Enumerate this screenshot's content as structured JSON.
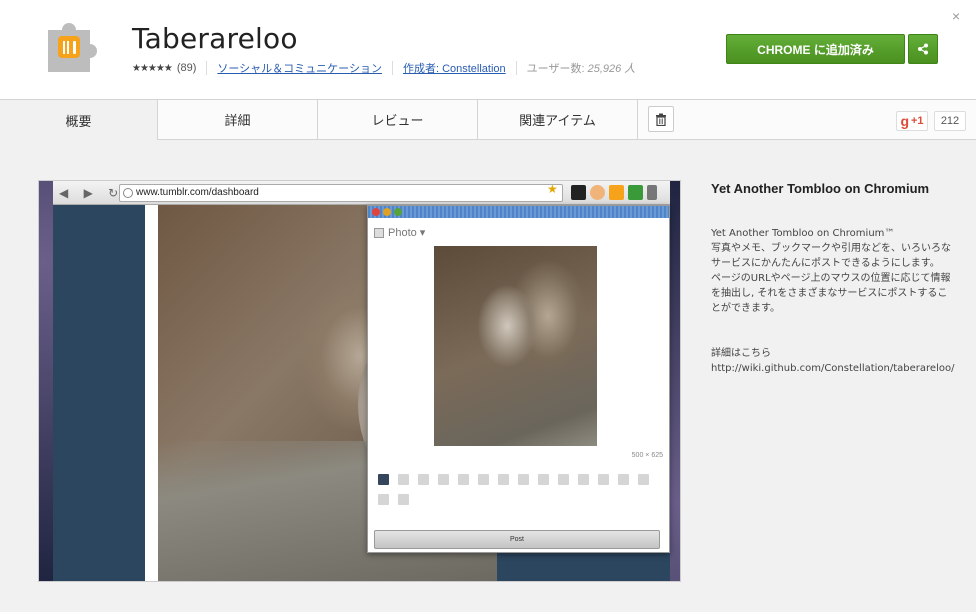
{
  "header": {
    "title": "Taberareloo",
    "rating_stars": "★★★★★",
    "rating_count": "(89)",
    "category": "ソーシャル＆コミュニケーション",
    "author": "作成者: Constellation",
    "users_label": "ユーザー数: ",
    "users_count": "25,926 人",
    "add_button": "CHROME に追加済み",
    "close": "×"
  },
  "tabs": [
    {
      "label": "概要"
    },
    {
      "label": "詳細"
    },
    {
      "label": "レビュー"
    },
    {
      "label": "関連アイテム"
    }
  ],
  "gplus": {
    "g": "g",
    "plus_one": "+1",
    "count": "212"
  },
  "screenshot": {
    "url": "www.tumblr.com/dashboard",
    "popup_type": "Photo ▾",
    "image_size": "500 × 625",
    "post_button": "Post"
  },
  "description": {
    "title": "Yet Another Tombloo on Chromium",
    "line1": "Yet Another Tombloo on Chromium™",
    "line2": "写真やメモ、ブックマークや引用などを、いろいろなサービスにかんたんにポストできるようにします。",
    "line3": "ページのURLやページ上のマウスの位置に応じて情報を抽出し, それをさまざまなサービスにポストすることができます。",
    "more_label": "詳細はこちら",
    "more_url": "http://wiki.github.com/Constellation/taberareloo/"
  },
  "colors": {
    "accent_green": "#4a9020",
    "link_blue": "#2a5db0"
  }
}
